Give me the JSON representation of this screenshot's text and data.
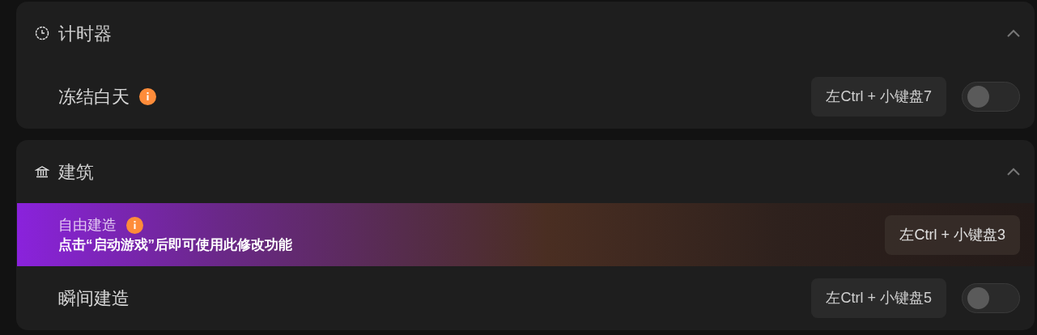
{
  "sections": [
    {
      "title": "计时器",
      "expanded": true,
      "items": [
        {
          "kind": "toggle",
          "label": "冻结白天",
          "info": true,
          "hotkey": "左Ctrl + 小键盘7",
          "on": false
        }
      ]
    },
    {
      "title": "建筑",
      "expanded": true,
      "items": [
        {
          "kind": "locked",
          "label": "自由建造",
          "info": true,
          "notice": "点击“启动游戏”后即可使用此修改功能",
          "hotkey": "左Ctrl + 小键盘3"
        },
        {
          "kind": "toggle",
          "label": "瞬间建造",
          "info": false,
          "hotkey": "左Ctrl + 小键盘5",
          "on": false
        }
      ]
    }
  ]
}
